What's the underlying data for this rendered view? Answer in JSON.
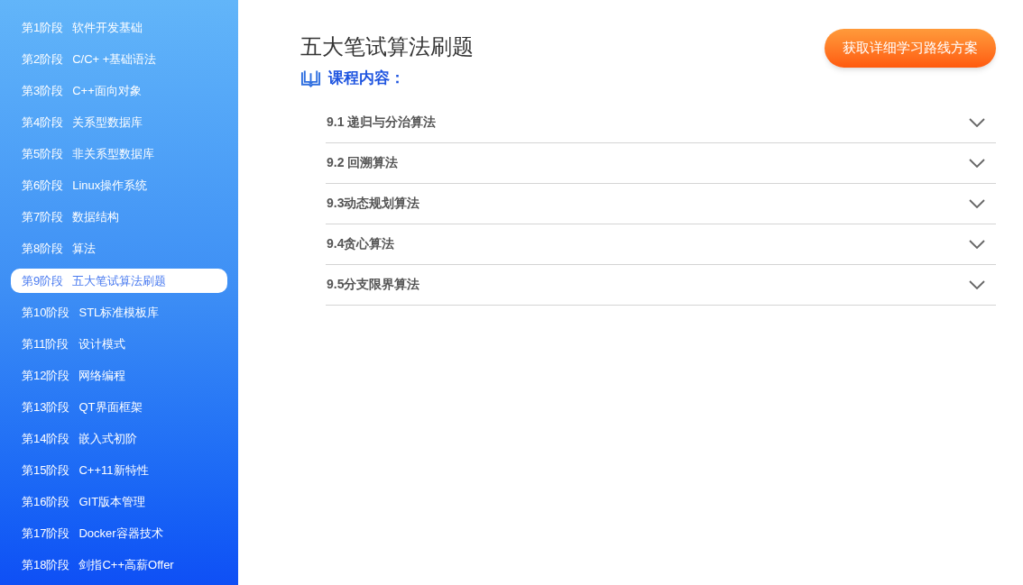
{
  "sidebar": {
    "items": [
      {
        "stage": "第1阶段",
        "name": "软件开发基础",
        "selected": false
      },
      {
        "stage": "第2阶段",
        "name": "C/C+ +基础语法",
        "selected": false
      },
      {
        "stage": "第3阶段",
        "name": "C++面向对象",
        "selected": false
      },
      {
        "stage": "第4阶段",
        "name": "关系型数据库",
        "selected": false
      },
      {
        "stage": "第5阶段",
        "name": "非关系型数据库",
        "selected": false
      },
      {
        "stage": "第6阶段",
        "name": "Linux操作系统",
        "selected": false
      },
      {
        "stage": "第7阶段",
        "name": "数据结构",
        "selected": false
      },
      {
        "stage": "第8阶段",
        "name": "算法",
        "selected": false
      },
      {
        "stage": "第9阶段",
        "name": "五大笔试算法刷题",
        "selected": true
      },
      {
        "stage": "第10阶段",
        "name": "STL标准模板库",
        "selected": false
      },
      {
        "stage": "第11阶段",
        "name": "设计模式",
        "selected": false
      },
      {
        "stage": "第12阶段",
        "name": "网络编程",
        "selected": false
      },
      {
        "stage": "第13阶段",
        "name": "QT界面框架",
        "selected": false
      },
      {
        "stage": "第14阶段",
        "name": "嵌入式初阶",
        "selected": false
      },
      {
        "stage": "第15阶段",
        "name": "C++11新特性",
        "selected": false
      },
      {
        "stage": "第16阶段",
        "name": "GIT版本管理",
        "selected": false
      },
      {
        "stage": "第17阶段",
        "name": "Docker容器技术",
        "selected": false
      },
      {
        "stage": "第18阶段",
        "name": "剑指C++高薪Offer",
        "selected": false
      }
    ]
  },
  "content": {
    "title": "五大笔试算法刷题",
    "cta_button": "获取详细学习路线方案",
    "section_heading": "课程内容：",
    "lessons": [
      {
        "title": "9.1 递归与分治算法",
        "expanded": false
      },
      {
        "title": "9.2 回溯算法",
        "expanded": false
      },
      {
        "title": "9.3动态规划算法",
        "expanded": false
      },
      {
        "title": "9.4贪心算法",
        "expanded": false
      },
      {
        "title": "9.5分支限界算法",
        "expanded": false
      }
    ]
  }
}
